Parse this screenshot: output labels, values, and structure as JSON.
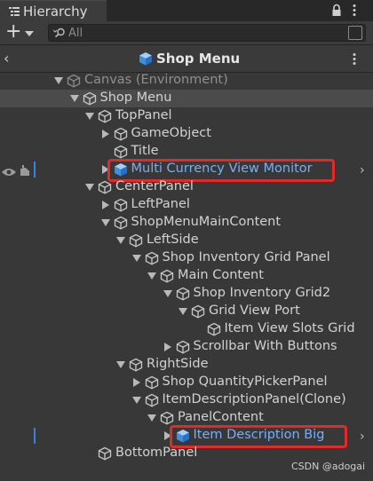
{
  "tab": {
    "title": "Hierarchy"
  },
  "toolbar": {
    "create_label": "+",
    "search_placeholder": "All"
  },
  "breadcrumb": {
    "title": "Shop Menu"
  },
  "tree": [
    {
      "label": "Canvas (Environment)",
      "depth": 0,
      "expand": "down",
      "style": "dim"
    },
    {
      "label": "Shop Menu",
      "depth": 1,
      "expand": "down",
      "style": "normal",
      "selected": true
    },
    {
      "label": "TopPanel",
      "depth": 2,
      "expand": "down",
      "style": "normal"
    },
    {
      "label": "GameObject",
      "depth": 3,
      "expand": "right",
      "style": "normal"
    },
    {
      "label": "Title",
      "depth": 3,
      "expand": "none",
      "style": "normal"
    },
    {
      "label": "Multi Currency View Monitor",
      "depth": 3,
      "expand": "right",
      "style": "blue",
      "prefab": true,
      "highlighted": true,
      "chevron": true,
      "hover": true
    },
    {
      "label": "CenterPanel",
      "depth": 2,
      "expand": "down",
      "style": "normal"
    },
    {
      "label": "LeftPanel",
      "depth": 3,
      "expand": "right",
      "style": "normal"
    },
    {
      "label": "ShopMenuMainContent",
      "depth": 3,
      "expand": "down",
      "style": "normal"
    },
    {
      "label": "LeftSide",
      "depth": 4,
      "expand": "down",
      "style": "normal"
    },
    {
      "label": "Shop Inventory Grid Panel",
      "depth": 5,
      "expand": "down",
      "style": "normal"
    },
    {
      "label": "Main Content",
      "depth": 6,
      "expand": "down",
      "style": "normal"
    },
    {
      "label": "Shop Inventory Grid2",
      "depth": 7,
      "expand": "down",
      "style": "normal"
    },
    {
      "label": "Grid View Port",
      "depth": 8,
      "expand": "down",
      "style": "normal"
    },
    {
      "label": "Item View Slots Grid",
      "depth": 9,
      "expand": "none",
      "style": "normal"
    },
    {
      "label": "Scrollbar With Buttons",
      "depth": 7,
      "expand": "right",
      "style": "normal"
    },
    {
      "label": "RightSide",
      "depth": 4,
      "expand": "down",
      "style": "normal"
    },
    {
      "label": "Shop QuantityPickerPanel",
      "depth": 5,
      "expand": "right",
      "style": "normal"
    },
    {
      "label": "ItemDescriptionPanel(Clone)",
      "depth": 5,
      "expand": "down",
      "style": "normal"
    },
    {
      "label": "PanelContent",
      "depth": 6,
      "expand": "down",
      "style": "normal"
    },
    {
      "label": "Item Description Big",
      "depth": 7,
      "expand": "right",
      "style": "blue",
      "prefab": true,
      "highlighted": true,
      "chevron": true,
      "mark": true
    },
    {
      "label": "BottomPanel",
      "depth": 2,
      "expand": "none",
      "style": "normal"
    }
  ],
  "watermark": "CSDN @adogai",
  "colors": {
    "highlight": "#e12b2b",
    "prefab_blue": "#78aef5",
    "background": "#383838"
  }
}
